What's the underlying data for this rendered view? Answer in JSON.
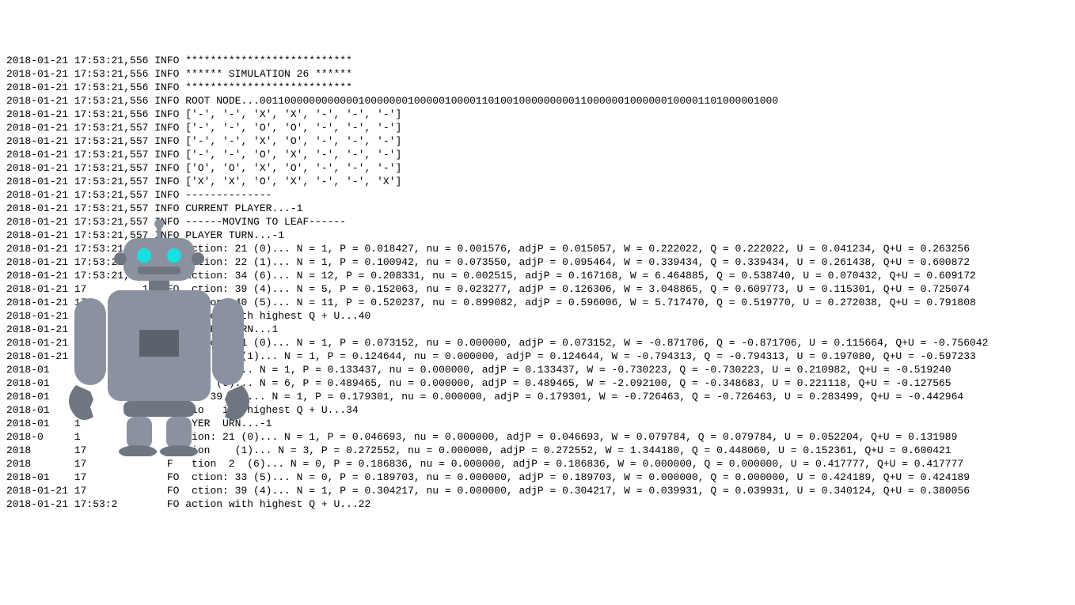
{
  "lines": [
    "2018-01-21 17:53:21,556 INFO ***************************",
    "2018-01-21 17:53:21,556 INFO ****** SIMULATION 26 ******",
    "2018-01-21 17:53:21,556 INFO ***************************",
    "2018-01-21 17:53:21,556 INFO ROOT NODE...001100000000000010000000100000100001101001000000000110000001000000100001101000001000",
    "2018-01-21 17:53:21,556 INFO ['-', '-', 'X', 'X', '-', '-', '-']",
    "2018-01-21 17:53:21,557 INFO ['-', '-', 'O', 'O', '-', '-', '-']",
    "2018-01-21 17:53:21,557 INFO ['-', '-', 'X', 'O', '-', '-', '-']",
    "2018-01-21 17:53:21,557 INFO ['-', '-', 'O', 'X', '-', '-', '-']",
    "2018-01-21 17:53:21,557 INFO ['O', 'O', 'X', 'O', '-', '-', '-']",
    "2018-01-21 17:53:21,557 INFO ['X', 'X', 'O', 'X', '-', '-', 'X']",
    "2018-01-21 17:53:21,557 INFO --------------",
    "2018-01-21 17:53:21,557 INFO CURRENT PLAYER...-1",
    "2018-01-21 17:53:21,557 INFO ------MOVING TO LEAF------",
    "2018-01-21 17:53:21,557 INFO PLAYER TURN...-1",
    "2018-01-21 17:53:21,557 INFO action: 21 (0)... N = 1, P = 0.018427, nu = 0.001576, adjP = 0.015057, W = 0.222022, Q = 0.222022, U = 0.041234, Q+U = 0.263256",
    "2018-01-21 17:53:21,557 INFO action: 22 (1)... N = 1, P = 0.100942, nu = 0.073550, adjP = 0.095464, W = 0.339434, Q = 0.339434, U = 0.261438, Q+U = 0.600872",
    "2018-01-21 17:53:21,557 INFO action: 34 (6)... N = 12, P = 0.208331, nu = 0.002515, adjP = 0.167168, W = 6.464885, Q = 0.538740, U = 0.070432, Q+U = 0.609172",
    "2018-01-21 17         1 INFO  ction: 39 (4)... N = 5, P = 0.152063, nu = 0.023277, adjP = 0.126306, W = 3.048865, Q = 0.609773, U = 0.115301, Q+U = 0.725074",
    "2018-01-21 17             FO  ction: 40 (5)... N = 11, P = 0.520237, nu = 0.899082, adjP = 0.596006, W = 5.717470, Q = 0.519770, U = 0.272038, Q+U = 0.791808",
    "2018-01-21 17             FO  ction with highest Q + U...40",
    "2018-01-21 17:53:21,      FO PLAYER TURN...1",
    "2018-01-21 17:53:21,    INFO action: 21 (0)... N = 1, P = 0.073152, nu = 0.000000, adjP = 0.073152, W = -0.871706, Q = -0.871706, U = 0.115664, Q+U = -0.756042",
    "2018-01-21 1                 tion: 22 (1)... N = 1, P = 0.124644, nu = 0.000000, adjP = 0.124644, W = -0.794313, Q = -0.794313, U = 0.197080, Q+U = -0.597233",
    "2018-01                        33 (5)... N = 1, P = 0.133437, nu = 0.000000, adjP = 0.133437, W = -0.730223, Q = -0.730223, U = 0.210982, Q+U = -0.519240",
    "2018-01                        34 (6)... N = 6, P = 0.489465, nu = 0.000000, adjP = 0.489465, W = -2.092100, Q = -0.348683, U = 0.221118, Q+U = -0.127565",
    "2018-01                      io  39 (4)... N = 1, P = 0.179301, nu = 0.000000, adjP = 0.179301, W = -0.726463, Q = -0.726463, U = 0.283499, Q+U = -0.442964",
    "2018-01    1                 tio   ith highest Q + U...34",
    "2018-01    1                 AYER  URN...-1",
    "2018-0     1                 tion: 21 (0)... N = 1, P = 0.046693, nu = 0.000000, adjP = 0.046693, W = 0.079784, Q = 0.079784, U = 0.052204, Q+U = 0.131989",
    "2018       17                tion    (1)... N = 3, P = 0.272552, nu = 0.000000, adjP = 0.272552, W = 1.344180, Q = 0.448060, U = 0.152361, Q+U = 0.600421",
    "2018       17             F   tion  2  (6)... N = 0, P = 0.186836, nu = 0.000000, adjP = 0.186836, W = 0.000000, Q = 0.000000, U = 0.417777, Q+U = 0.417777",
    "2018-01    17             FO  ction: 33 (5)... N = 0, P = 0.189703, nu = 0.000000, adjP = 0.189703, W = 0.000000, Q = 0.000000, U = 0.424189, Q+U = 0.424189",
    "2018-01-21 17             FO  ction: 39 (4)... N = 1, P = 0.304217, nu = 0.000000, adjP = 0.304217, W = 0.039931, Q = 0.039931, U = 0.340124, Q+U = 0.380056",
    "2018-01-21 17:53:2        FO action with highest Q + U...22"
  ],
  "robot": {
    "body_color": "#8a92a0",
    "body_dark": "#6e7682",
    "eye_color": "#18e0e0",
    "panel_color": "#5c626c"
  }
}
